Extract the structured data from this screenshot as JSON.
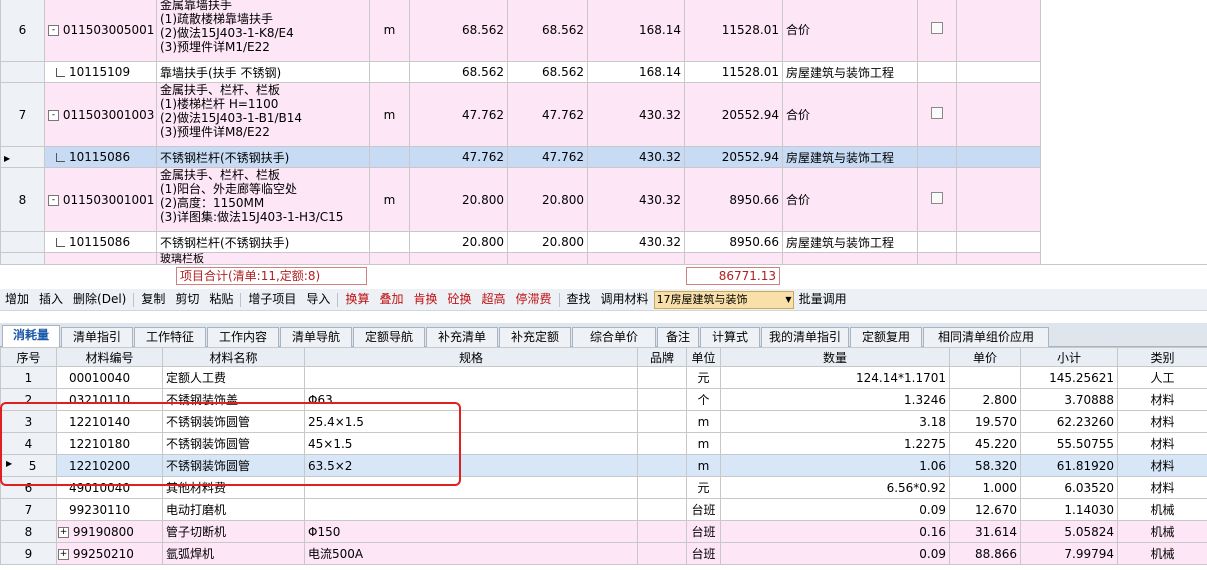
{
  "top_rows": [
    {
      "kind": "main",
      "num": "6",
      "code": "011503005001",
      "name_lines": [
        "金属靠墙扶手",
        "(1)疏散楼梯靠墙扶手",
        "(2)做法15J403-1-K8/E4",
        "(3)预埋件详M1/E22"
      ],
      "unit": "m",
      "qty1": "68.562",
      "qty2": "68.562",
      "price": "168.14",
      "total": "11528.01",
      "type": "合价"
    },
    {
      "kind": "sub",
      "code": "10115109",
      "name": "靠墙扶手(扶手 不锈钢)",
      "qty1": "68.562",
      "qty2": "68.562",
      "price": "168.14",
      "total": "11528.01",
      "type": "房屋建筑与装饰工程"
    },
    {
      "kind": "main",
      "num": "7",
      "code": "011503001003",
      "name_lines": [
        "金属扶手、栏杆、栏板",
        "(1)楼梯栏杆 H=1100",
        "(2)做法15J403-1-B1/B14",
        "(3)预埋件详M8/E22"
      ],
      "unit": "m",
      "qty1": "47.762",
      "qty2": "47.762",
      "price": "430.32",
      "total": "20552.94",
      "type": "合价"
    },
    {
      "kind": "sub",
      "selected": true,
      "code": "10115086",
      "name": "不锈钢栏杆(不锈钢扶手)",
      "qty1": "47.762",
      "qty2": "47.762",
      "price": "430.32",
      "total": "20552.94",
      "type": "房屋建筑与装饰工程"
    },
    {
      "kind": "main",
      "num": "8",
      "code": "011503001001",
      "name_lines": [
        "金属扶手、栏杆、栏板",
        "(1)阳台、外走廊等临空处",
        "(2)高度：1150MM",
        "(3)详图集:做法15J403-1-H3/C15"
      ],
      "unit": "m",
      "qty1": "20.800",
      "qty2": "20.800",
      "price": "430.32",
      "total": "8950.66",
      "type": "合价"
    },
    {
      "kind": "sub",
      "code": "10115086",
      "name": "不锈钢栏杆(不锈钢扶手)",
      "qty1": "20.800",
      "qty2": "20.800",
      "price": "430.32",
      "total": "8950.66",
      "type": "房屋建筑与装饰工程"
    }
  ],
  "partial_row_text": "玻璃栏板",
  "summary": {
    "label": "项目合计(清单:11,定额:8)",
    "total": "86771.13"
  },
  "toolbar": {
    "items": [
      {
        "label": "增加",
        "red": false
      },
      {
        "label": "插入",
        "red": false
      },
      {
        "label": "删除(Del)",
        "red": false
      },
      {
        "label": "复制",
        "red": false
      },
      {
        "label": "剪切",
        "red": false
      },
      {
        "label": "粘贴",
        "red": false
      },
      {
        "label": "增子项目",
        "red": false
      },
      {
        "label": "导入",
        "red": false
      },
      {
        "label": "换算",
        "red": true
      },
      {
        "label": "叠加",
        "red": true
      },
      {
        "label": "肯换",
        "red": true
      },
      {
        "label": "砼换",
        "red": true
      },
      {
        "label": "超高",
        "red": true
      },
      {
        "label": "停滞费",
        "red": true
      },
      {
        "label": "查找",
        "red": false
      },
      {
        "label": "调用材料",
        "red": false
      }
    ],
    "combo_value": "17房屋建筑与装饰",
    "batch_label": "批量调用"
  },
  "tabs": [
    "消耗量",
    "清单指引",
    "工作特征",
    "工作内容",
    "清单导航",
    "定额导航",
    "补充清单",
    "补充定额",
    "综合单价",
    "备注",
    "计算式",
    "我的清单指引",
    "定额复用",
    "相同清单组价应用"
  ],
  "columns": [
    "序号",
    "材料编号",
    "材料名称",
    "规格",
    "品牌",
    "单位",
    "数量",
    "单价",
    "小计",
    "类别"
  ],
  "materials": [
    {
      "no": "1",
      "code": "00010040",
      "name": "定额人工费",
      "spec": "",
      "brand": "",
      "unit": "元",
      "qty": "124.14*1.1701",
      "price": "",
      "subtotal": "145.25621",
      "cat": "人工"
    },
    {
      "no": "2",
      "code": "03210110",
      "name": "不锈钢装饰盖",
      "spec": "Φ63",
      "brand": "",
      "unit": "个",
      "qty": "1.3246",
      "price": "2.800",
      "subtotal": "3.70888",
      "cat": "材料"
    },
    {
      "no": "3",
      "code": "12210140",
      "name": "不锈钢装饰圆管",
      "spec": "25.4×1.5",
      "brand": "",
      "unit": "m",
      "qty": "3.18",
      "price": "19.570",
      "subtotal": "62.23260",
      "cat": "材料"
    },
    {
      "no": "4",
      "code": "12210180",
      "name": "不锈钢装饰圆管",
      "spec": "45×1.5",
      "brand": "",
      "unit": "m",
      "qty": "1.2275",
      "price": "45.220",
      "subtotal": "55.50755",
      "cat": "材料"
    },
    {
      "no": "5",
      "code": "12210200",
      "name": "不锈钢装饰圆管",
      "spec": "63.5×2",
      "brand": "",
      "unit": "m",
      "qty": "1.06",
      "price": "58.320",
      "subtotal": "61.81920",
      "cat": "材料",
      "selected": true
    },
    {
      "no": "6",
      "code": "49010040",
      "name": "其他材料费",
      "spec": "",
      "brand": "",
      "unit": "元",
      "qty": "6.56*0.92",
      "price": "1.000",
      "subtotal": "6.03520",
      "cat": "材料"
    },
    {
      "no": "7",
      "code": "99230110",
      "name": "电动打磨机",
      "spec": "",
      "brand": "",
      "unit": "台班",
      "qty": "0.09",
      "price": "12.670",
      "subtotal": "1.14030",
      "cat": "机械"
    },
    {
      "no": "8",
      "code": "99190800",
      "name": "管子切断机",
      "spec": "Φ150",
      "brand": "",
      "unit": "台班",
      "qty": "0.16",
      "price": "31.614",
      "subtotal": "5.05824",
      "cat": "机械",
      "expandable": true
    },
    {
      "no": "9",
      "code": "99250210",
      "name": "氩弧焊机",
      "spec": "电流500A",
      "brand": "",
      "unit": "台班",
      "qty": "0.09",
      "price": "88.866",
      "subtotal": "7.99794",
      "cat": "机械",
      "expandable": true
    }
  ]
}
